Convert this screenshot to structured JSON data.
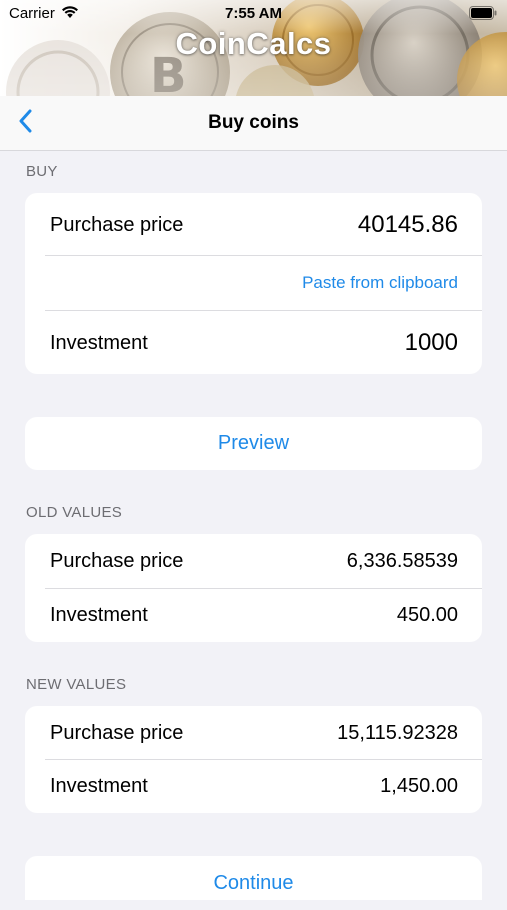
{
  "status_bar": {
    "carrier": "Carrier",
    "time": "7:55 AM"
  },
  "banner": {
    "app_title": "CoinCalcs"
  },
  "nav": {
    "title": "Buy coins",
    "back_icon": "chevron-left-icon"
  },
  "buy": {
    "header": "BUY",
    "purchase_price_label": "Purchase price",
    "purchase_price_value": "40145.86",
    "paste_label": "Paste from clipboard",
    "investment_label": "Investment",
    "investment_value": "1000"
  },
  "preview_label": "Preview",
  "old_values": {
    "header": "OLD VALUES",
    "purchase_price_label": "Purchase price",
    "purchase_price_value": "6,336.58539",
    "investment_label": "Investment",
    "investment_value": "450.00"
  },
  "new_values": {
    "header": "NEW VALUES",
    "purchase_price_label": "Purchase price",
    "purchase_price_value": "15,115.92328",
    "investment_label": "Investment",
    "investment_value": "1,450.00"
  },
  "continue_label": "Continue",
  "colors": {
    "accent": "#1f8ae8",
    "background": "#f2f2f7",
    "section_header": "#6d6d72"
  }
}
